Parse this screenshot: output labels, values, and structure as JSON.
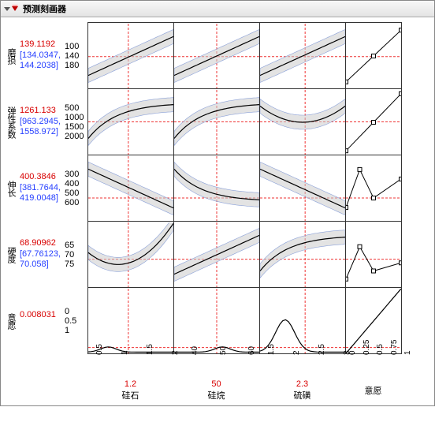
{
  "title": "预测刻画器",
  "rows": [
    {
      "name": "磨损",
      "value": "139.1192",
      "ci_lo": "[134.0347,",
      "ci_hi": "144.2038]"
    },
    {
      "name": "弹性系数",
      "value": "1261.133",
      "ci_lo": "[963.2945,",
      "ci_hi": "1558.972]"
    },
    {
      "name": "伸长",
      "value": "400.3846",
      "ci_lo": "[381.7644,",
      "ci_hi": "419.0048]"
    },
    {
      "name": "硬度",
      "value": "68.90962",
      "ci_lo": "[67.76123,",
      "ci_hi": "70.058]"
    },
    {
      "name": "意愿",
      "value": "0.008031",
      "ci_lo": "",
      "ci_hi": ""
    }
  ],
  "cols": [
    {
      "name": "硅石",
      "value": "1.2",
      "ticks": [
        "0.5",
        "1",
        "1.5",
        "2"
      ]
    },
    {
      "name": "硅烷",
      "value": "50",
      "ticks": [
        "40",
        "50",
        "60"
      ]
    },
    {
      "name": "硫磺",
      "value": "2.3",
      "ticks": [
        "1.5",
        "2",
        "2.5",
        "3"
      ]
    },
    {
      "name": "意愿",
      "value": "",
      "ticks": [
        "0",
        "0.25",
        "0.5",
        "0.75",
        "1"
      ]
    }
  ],
  "yticks": [
    [
      "100",
      "140",
      "180"
    ],
    [
      "500",
      "1000",
      "1500",
      "2000"
    ],
    [
      "300",
      "400",
      "500",
      "600"
    ],
    [
      "65",
      "70",
      "75"
    ],
    [
      "0",
      "0.5",
      "1"
    ]
  ],
  "chart_data": {
    "type": "profiler-matrix",
    "description": "JMP prediction profiler: 5 responses × 4 factors grid of line plots with confidence bands, vertical dashed red lines at current factor settings and horizontal dashed red lines at predicted response values.",
    "factor_settings": {
      "硅石": 1.2,
      "硅烷": 50,
      "硫磺": 2.3
    },
    "responses": {
      "磨损": {
        "pred": 139.1192,
        "ci": [
          134.0347,
          144.2038
        ],
        "ylim": [
          90,
          190
        ]
      },
      "弹性系数": {
        "pred": 1261.133,
        "ci": [
          963.2945,
          1558.972
        ],
        "ylim": [
          400,
          2100
        ]
      },
      "伸长": {
        "pred": 400.3846,
        "ci": [
          381.7644,
          419.0048
        ],
        "ylim": [
          280,
          620
        ]
      },
      "硬度": {
        "pred": 68.90962,
        "ci": [
          67.76123,
          70.058
        ],
        "ylim": [
          62,
          78
        ]
      },
      "意愿": {
        "pred": 0.008031,
        "ci": null,
        "ylim": [
          -0.1,
          1.1
        ]
      }
    },
    "factors": {
      "硅石": {
        "range": [
          0.4,
          2.1
        ]
      },
      "硅烷": {
        "range": [
          35,
          65
        ]
      },
      "硫磺": {
        "range": [
          1.4,
          3.1
        ]
      },
      "意愿": {
        "range": [
          0,
          1
        ],
        "desirability_trace": true
      }
    },
    "traces": [
      {
        "row": "磨损",
        "col": "硅石",
        "shape": "increasing-linear",
        "band": true
      },
      {
        "row": "磨损",
        "col": "硅烷",
        "shape": "increasing-linear",
        "band": true
      },
      {
        "row": "磨损",
        "col": "硫磺",
        "shape": "increasing-linear",
        "band": true
      },
      {
        "row": "磨损",
        "col": "意愿",
        "shape": "desirability-maximize",
        "points": [
          [
            0,
            100
          ],
          [
            0.5,
            140
          ],
          [
            1,
            180
          ]
        ]
      },
      {
        "row": "弹性系数",
        "col": "硅石",
        "shape": "increasing-saturating",
        "band": true
      },
      {
        "row": "弹性系数",
        "col": "硅烷",
        "shape": "increasing-saturating",
        "band": true
      },
      {
        "row": "弹性系数",
        "col": "硫磺",
        "shape": "u-shape-shallow",
        "band": true
      },
      {
        "row": "弹性系数",
        "col": "意愿",
        "shape": "desirability-maximize",
        "points": [
          [
            0,
            500
          ],
          [
            0.5,
            1250
          ],
          [
            1,
            2000
          ]
        ]
      },
      {
        "row": "伸长",
        "col": "硅石",
        "shape": "decreasing-linear",
        "band": true
      },
      {
        "row": "伸长",
        "col": "硅烷",
        "shape": "decreasing-saturating",
        "band": true
      },
      {
        "row": "伸长",
        "col": "硫磺",
        "shape": "decreasing-linear",
        "band": true
      },
      {
        "row": "伸长",
        "col": "意愿",
        "shape": "desirability-target",
        "points": [
          [
            0,
            350
          ],
          [
            0.25,
            550
          ],
          [
            0.5,
            400
          ],
          [
            1,
            500
          ]
        ]
      },
      {
        "row": "硬度",
        "col": "硅石",
        "shape": "u-shape",
        "band": true
      },
      {
        "row": "硬度",
        "col": "硅烷",
        "shape": "increasing-linear",
        "band": true
      },
      {
        "row": "硬度",
        "col": "硫磺",
        "shape": "increasing-saturating",
        "band": true
      },
      {
        "row": "硬度",
        "col": "意愿",
        "shape": "desirability-target",
        "points": [
          [
            0,
            64
          ],
          [
            0.25,
            72
          ],
          [
            0.5,
            66
          ],
          [
            1,
            68
          ]
        ]
      },
      {
        "row": "意愿",
        "col": "硅石",
        "shape": "low-bump",
        "peak_x": 0.8
      },
      {
        "row": "意愿",
        "col": "硅烷",
        "shape": "low-bump",
        "peak_x": 52
      },
      {
        "row": "意愿",
        "col": "硫磺",
        "shape": "bump",
        "peak_x": 1.9,
        "peak_y": 0.5
      },
      {
        "row": "意愿",
        "col": "意愿",
        "shape": "identity-line"
      }
    ]
  }
}
